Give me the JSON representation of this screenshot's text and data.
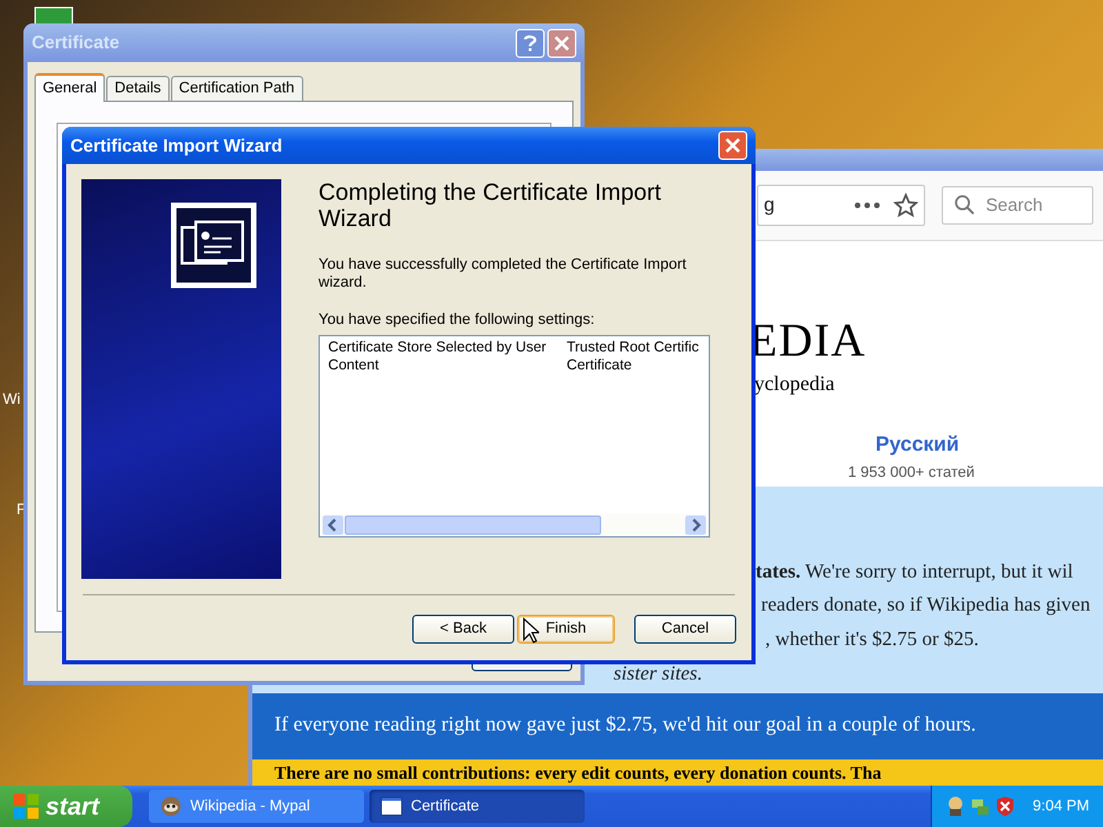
{
  "desktop": {
    "icon_labels": [
      "Wi",
      "F"
    ]
  },
  "certificate_window": {
    "title": "Certificate",
    "tabs": [
      {
        "label": "General",
        "selected": true
      },
      {
        "label": "Details",
        "selected": false
      },
      {
        "label": "Certification Path",
        "selected": false
      }
    ]
  },
  "browser": {
    "address": "g",
    "search": {
      "placeholder": "Search"
    },
    "logo": "EDIA",
    "tagline": "yclopedia",
    "language": {
      "name": "Русский",
      "count": "1 953 000+ статей"
    },
    "appeal_lines": [
      {
        "text": "**tates.** We're sorry to interrupt, but it wil",
        "italic": false
      },
      {
        "text": "readers donate, so if Wikipedia has given",
        "italic": false
      },
      {
        "text": ", whether it's $2.75 or $25.",
        "italic": false
      },
      {
        "text": "sister sites.",
        "italic": true
      }
    ],
    "goal_text": "If everyone reading right now gave just $2.75, we'd hit our goal in a couple of hours.",
    "highlight_text": "There are no small contributions: every edit counts, every donation counts. Tha"
  },
  "wizard": {
    "title": "Certificate Import Wizard",
    "heading": "Completing the Certificate Import Wizard",
    "message": "You have successfully completed the Certificate Import wizard.",
    "settings_label": "You have specified the following settings:",
    "settings": [
      {
        "column_1": "Certificate Store Selected by User",
        "column_2": "Trusted Root Certific"
      },
      {
        "column_1": "Content",
        "column_2": "Certificate"
      }
    ],
    "buttons": [
      {
        "label": "< Back",
        "default": false
      },
      {
        "label": "Finish",
        "default": true
      },
      {
        "label": "Cancel",
        "default": false
      }
    ]
  },
  "taskbar": {
    "start": "start",
    "tasks": [
      {
        "label": "Wikipedia - Mypal",
        "selected": false
      },
      {
        "label": "Certificate",
        "selected": true
      }
    ],
    "clock": "9:04 PM"
  }
}
